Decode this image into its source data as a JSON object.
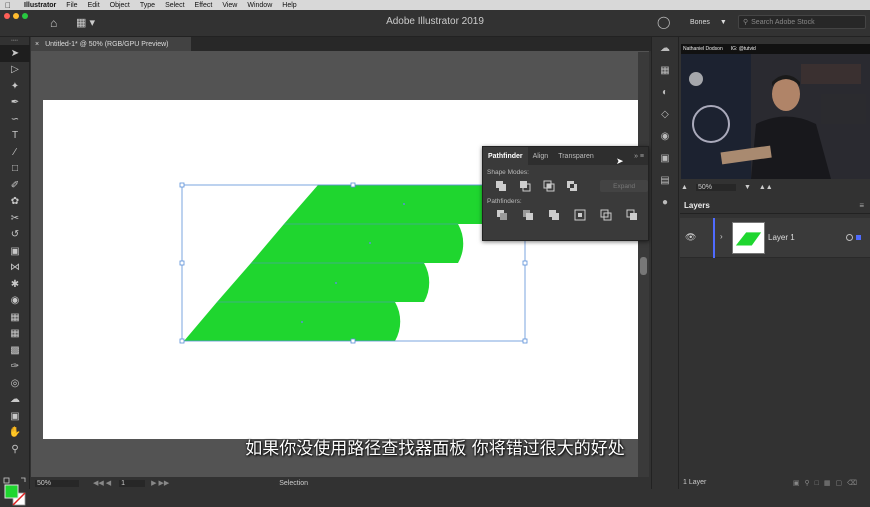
{
  "menubar": {
    "app": "Illustrator",
    "items": [
      "File",
      "Edit",
      "Object",
      "Type",
      "Select",
      "Effect",
      "View",
      "Window",
      "Help"
    ]
  },
  "appbar": {
    "title": "Adobe Illustrator 2019",
    "workspace": "Bones",
    "search_placeholder": "Search Adobe Stock"
  },
  "document": {
    "tab_title": "Untitled-1* @ 50% (RGB/GPU Preview)",
    "close_glyph": "×"
  },
  "status": {
    "zoom": "50%",
    "artboard": "1",
    "tool": "Selection"
  },
  "pathfinder": {
    "tabs": [
      "Pathfinder",
      "Align",
      "Transparen"
    ],
    "shape_modes_label": "Shape Modes:",
    "expand_label": "Expand",
    "pathfinders_label": "Pathfinders:"
  },
  "video": {
    "name": "Nathaniel Dodson",
    "handle": "IG: @tutvid"
  },
  "navigator": {
    "zoom": "50%"
  },
  "layers": {
    "title": "Layers",
    "items": [
      {
        "name": "Layer 1"
      }
    ],
    "count": "1 Layer"
  },
  "subtitle": "如果你没使用路径查找器面板 你将错过很大的好处",
  "colors": {
    "shape_fill": "#1fd62f",
    "layer_color": "#4f6bff",
    "fill_swatch": "#1fd62f"
  }
}
